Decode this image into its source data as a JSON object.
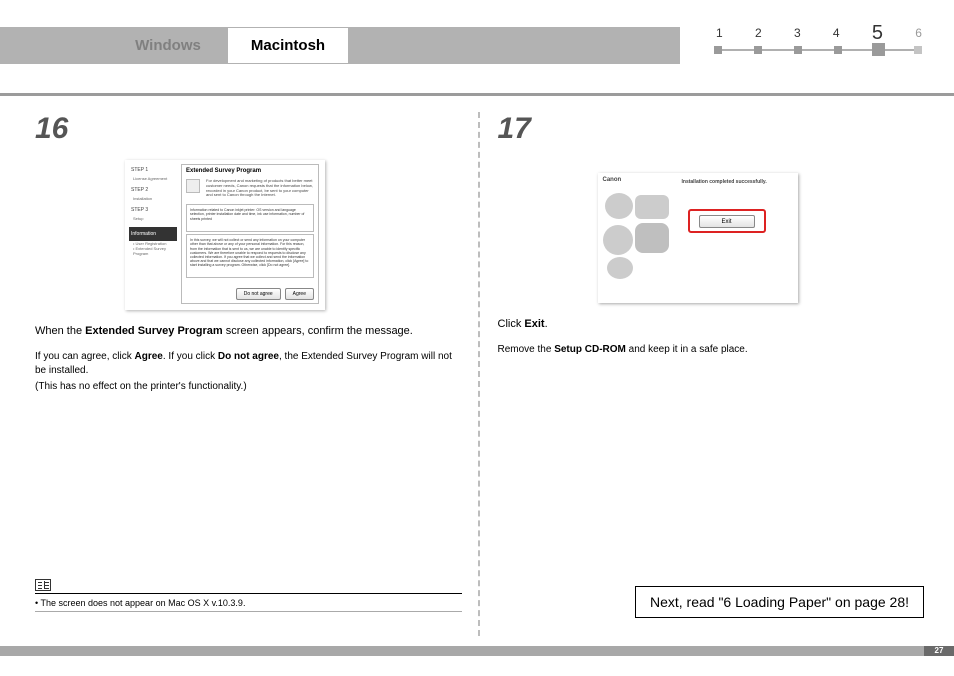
{
  "header": {
    "tabs": {
      "inactive": "Windows",
      "active": "Macintosh"
    },
    "progress": {
      "steps": [
        "1",
        "2",
        "3",
        "4",
        "5",
        "6"
      ],
      "current_index": 4
    }
  },
  "left": {
    "step_number": "16",
    "shot": {
      "sidebar": {
        "s1": "STEP 1",
        "s1a": "License Agreement",
        "s2": "STEP 2",
        "s2a": "Installation",
        "s3": "STEP 3",
        "s3a": "Setup",
        "info": "Information",
        "info_lines": "• User Registration\n• Extended Survey Program"
      },
      "title": "Extended Survey Program",
      "blurb": "For development and marketing of products that better meet customer needs, Canon requests that the information below, recorded in your Canon product, be sent to your computer and sent to Canon through the Internet.",
      "box1": "Information related to Canon inkjet printer: OS version and language selection, printer installation date and time, ink use information, number of sheets printed",
      "box2": "In this survey, we will not collect or send any information on your computer other than that above or any of your personal information. For this reason, from the information that is sent to us, we are unable to identify specific customers. We are therefore unable to respond to requests to disclose any collected information. If you agree that we collect and send the information above and that we cannot disclose any collected information, click [Agree] to start installing a survey program. Otherwise, click [Do not agree].",
      "btn_disagree": "Do not agree",
      "btn_agree": "Agree"
    },
    "main_line": {
      "pre": "When the ",
      "bold": "Extended Survey Program",
      "post": " screen appears, confirm the message."
    },
    "sub1": {
      "pre": "If you can agree, click ",
      "b1": "Agree",
      "mid": ". If you click ",
      "b2": "Do not agree",
      "post": ", the Extended Survey Program will not be installed."
    },
    "sub2": "(This has no effect on the printer's functionality.)",
    "note": "•  The screen does not appear on Mac OS X v.10.3.9."
  },
  "right": {
    "step_number": "17",
    "shot": {
      "brand": "Canon",
      "msg": "Installation completed successfully.",
      "exit": "Exit"
    },
    "line1": {
      "pre": "Click ",
      "bold": "Exit",
      "post": "."
    },
    "line2": {
      "pre": "Remove the ",
      "bold": "Setup CD-ROM",
      "post": " and keep it in a safe place."
    },
    "next_box": "Next, read \"6 Loading Paper\" on page 28!"
  },
  "page_number": "27"
}
